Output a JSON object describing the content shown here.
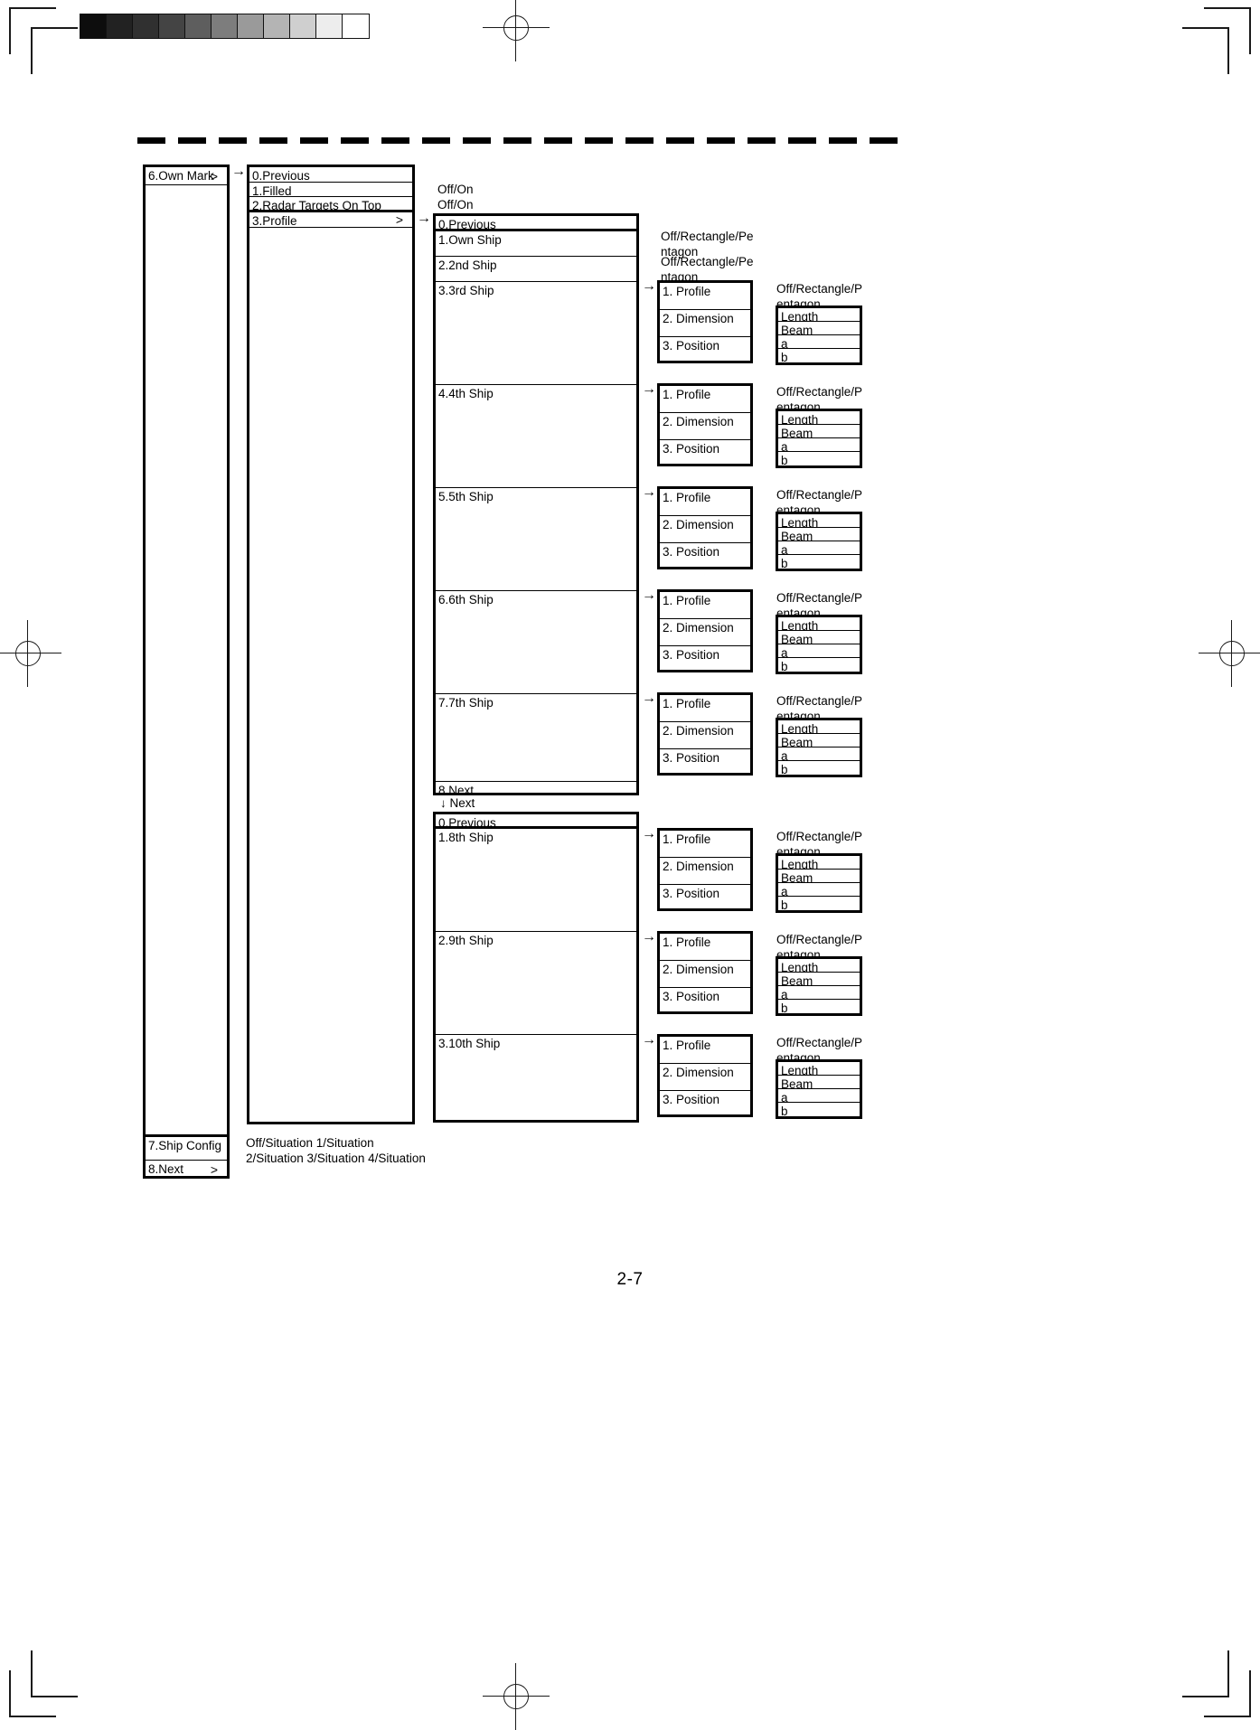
{
  "page": {
    "number": "2-7",
    "grayscale_swatches": [
      "#0d0d0d",
      "#222222",
      "#303030",
      "#444444",
      "#5e5e5e",
      "#7d7d7d",
      "#9a9a9a",
      "#b4b4b4",
      "#cfcfcf",
      "#ededed",
      "#ffffff"
    ]
  },
  "level1": {
    "rows": [
      {
        "label": "6.Own Mark",
        "chevron": ">"
      },
      {
        "label": "7.Ship Config",
        "chevron": ""
      },
      {
        "label": "8.Next",
        "chevron": ">"
      }
    ],
    "ship_config_note": "Off/Situation 1/Situation\n2/Situation 3/Situation 4/Situation"
  },
  "level2": {
    "rows": [
      {
        "label": "0.Previous",
        "chevron": "",
        "note": ""
      },
      {
        "label": "1.Filled",
        "chevron": "",
        "note": "Off/On"
      },
      {
        "label": "2.Radar Targets On Top",
        "chevron": "",
        "note": "Off/On"
      },
      {
        "label": "3.Profile",
        "chevron": ">",
        "note": ""
      }
    ]
  },
  "level3_page1": {
    "rows": [
      {
        "label": "0.Previous",
        "note": ""
      },
      {
        "label": "1.Own Ship",
        "note": "Off/Rectangle/Pe\nntagon"
      },
      {
        "label": "2.2nd Ship",
        "note": "Off/Rectangle/Pe\nntagon"
      },
      {
        "label": "3.3rd Ship",
        "note": ""
      },
      {
        "label": "4.4th Ship",
        "note": ""
      },
      {
        "label": "5.5th Ship",
        "note": ""
      },
      {
        "label": "6.6th Ship",
        "note": ""
      },
      {
        "label": "7.7th Ship",
        "note": ""
      },
      {
        "label": "8.Next",
        "note": ""
      }
    ],
    "next_label": "Next",
    "next_arrow": "↓"
  },
  "level3_page2": {
    "rows": [
      {
        "label": "0.Previous",
        "note": ""
      },
      {
        "label": "1.8th Ship",
        "note": ""
      },
      {
        "label": "2.9th Ship",
        "note": ""
      },
      {
        "label": "3.10th Ship",
        "note": ""
      }
    ]
  },
  "detail": {
    "menu_rows": [
      "1. Profile",
      "2. Dimension",
      "3. Position"
    ],
    "value_rows": [
      "Length",
      "Beam",
      "a",
      "b"
    ],
    "profile_note": "Off/Rectangle/P\nentagon"
  },
  "icons": {
    "arrow_right": "→",
    "arrow_down": "↓",
    "chevron_right": ">"
  }
}
